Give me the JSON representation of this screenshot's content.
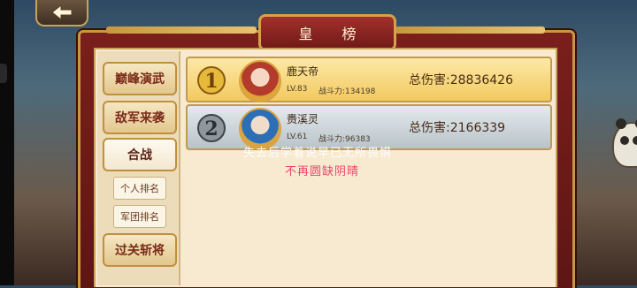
{
  "header": {
    "title": "皇  榜",
    "back_icon": "left-arrow-icon"
  },
  "sidebar": {
    "items": [
      {
        "label": "巅峰演武"
      },
      {
        "label": "敌军来袭"
      },
      {
        "label": "合战"
      },
      {
        "label": "过关斩将"
      }
    ],
    "sub_items": [
      {
        "label": "个人排名"
      },
      {
        "label": "军团排名"
      }
    ]
  },
  "ranking": [
    {
      "rank": "1",
      "name": "鹿天帝",
      "level": "LV.83",
      "power": "战斗力:134198",
      "damage": "总伤害:28836426"
    },
    {
      "rank": "2",
      "name": "赉溪灵",
      "level": "LV.61",
      "power": "战斗力:96383",
      "damage": "总伤害:2166339"
    }
  ],
  "overlay": {
    "line1": "失去后学着说早已无所畏惧",
    "line2": "不再圆缺阴晴"
  },
  "colors": {
    "frame": "#7a1f1c",
    "gold_row": "#f2c960",
    "silver_row": "#b8c3c9",
    "lyric_pink": "#f0436c"
  }
}
